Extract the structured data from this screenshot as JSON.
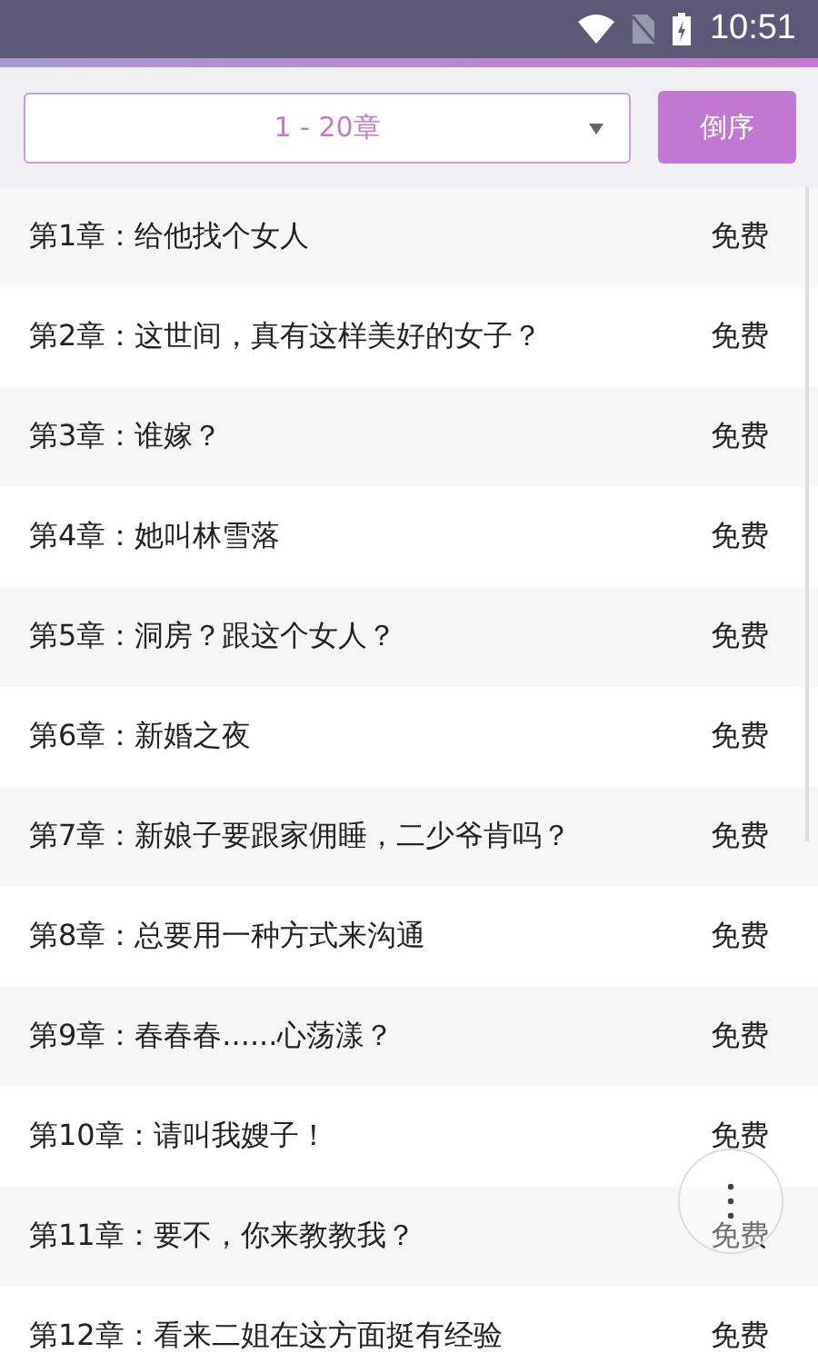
{
  "status_bar": {
    "time": "10:51"
  },
  "range_select": {
    "value": "1 - 20章"
  },
  "sort_button": {
    "label": "倒序"
  },
  "chapters": [
    {
      "title": "第1章：给他找个女人",
      "price": "免费"
    },
    {
      "title": "第2章：这世间，真有这样美好的女子？",
      "price": "免费"
    },
    {
      "title": "第3章：谁嫁？",
      "price": "免费"
    },
    {
      "title": "第4章：她叫林雪落",
      "price": "免费"
    },
    {
      "title": "第5章：洞房？跟这个女人？",
      "price": "免费"
    },
    {
      "title": "第6章：新婚之夜",
      "price": "免费"
    },
    {
      "title": "第7章：新娘子要跟家佣睡，二少爷肯吗？",
      "price": "免费"
    },
    {
      "title": "第8章：总要用一种方式来沟通",
      "price": "免费"
    },
    {
      "title": "第9章：春春春......心荡漾？",
      "price": "免费"
    },
    {
      "title": "第10章：请叫我嫂子！",
      "price": "免费"
    },
    {
      "title": "第11章：要不，你来教教我？",
      "price": "免费"
    },
    {
      "title": "第12章：看来二姐在这方面挺有经验",
      "price": "免费"
    }
  ]
}
